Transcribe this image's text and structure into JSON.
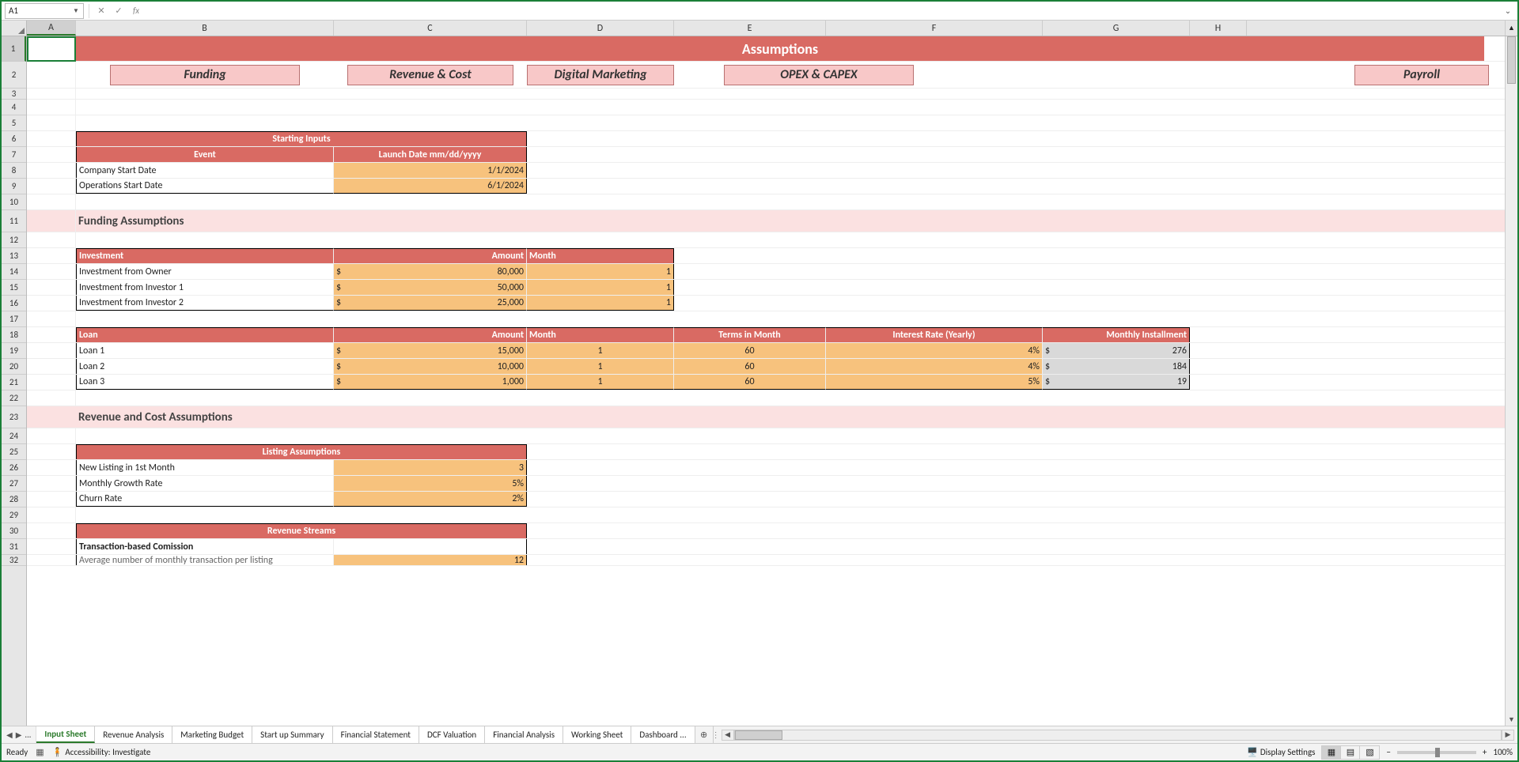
{
  "active_cell": "A1",
  "formula": "",
  "columns": [
    "A",
    "B",
    "C",
    "D",
    "E",
    "F",
    "G",
    "H"
  ],
  "row_numbers": [
    1,
    2,
    3,
    4,
    5,
    6,
    7,
    8,
    9,
    10,
    11,
    12,
    13,
    14,
    15,
    16,
    17,
    18,
    19,
    20,
    21,
    22,
    23,
    24,
    25,
    26,
    27,
    28,
    29,
    30,
    31,
    32
  ],
  "sheet": {
    "title": "Assumptions",
    "tabs": [
      "Funding",
      "Revenue & Cost",
      "Digital Marketing",
      "OPEX & CAPEX",
      "Payroll"
    ],
    "starting_inputs": {
      "header": "Starting Inputs",
      "col1": "Event",
      "col2": "Launch Date mm/dd/yyyy",
      "rows": [
        {
          "event": "Company Start Date",
          "date": "1/1/2024"
        },
        {
          "event": "Operations Start Date",
          "date": "6/1/2024"
        }
      ]
    },
    "section1": "Funding Assumptions",
    "investment": {
      "label": "Investment",
      "amount": "Amount",
      "month": "Month",
      "rows": [
        {
          "name": "Investment from Owner",
          "dollar": "$",
          "amount": "80,000",
          "month": "1"
        },
        {
          "name": "Investment from Investor 1",
          "dollar": "$",
          "amount": "50,000",
          "month": "1"
        },
        {
          "name": "Investment from Investor 2",
          "dollar": "$",
          "amount": "25,000",
          "month": "1"
        }
      ]
    },
    "loan": {
      "label": "Loan",
      "amount": "Amount",
      "month": "Month",
      "terms": "Terms in Month",
      "rate": "Interest Rate (Yearly)",
      "installment": "Monthly Installment",
      "rows": [
        {
          "name": "Loan 1",
          "dollar": "$",
          "amount": "15,000",
          "month": "1",
          "terms": "60",
          "rate": "4%",
          "d2": "$",
          "inst": "276"
        },
        {
          "name": "Loan 2",
          "dollar": "$",
          "amount": "10,000",
          "month": "1",
          "terms": "60",
          "rate": "4%",
          "d2": "$",
          "inst": "184"
        },
        {
          "name": "Loan 3",
          "dollar": "$",
          "amount": "1,000",
          "month": "1",
          "terms": "60",
          "rate": "5%",
          "d2": "$",
          "inst": "19"
        }
      ]
    },
    "section2": "Revenue and Cost Assumptions",
    "listing": {
      "header": "Listing Assumptions",
      "rows": [
        {
          "name": "New Listing in 1st Month",
          "val": "3"
        },
        {
          "name": "Monthly Growth Rate",
          "val": "5%"
        },
        {
          "name": "Churn Rate",
          "val": "2%"
        }
      ]
    },
    "revenue_streams": {
      "header": "Revenue Streams",
      "sub": "Transaction-based Comission",
      "row": {
        "name": "Average number of monthly transaction per listing",
        "val": "12"
      }
    }
  },
  "workbook_tabs": [
    "Input Sheet",
    "Revenue Analysis",
    "Marketing Budget",
    "Start up Summary",
    "Financial Statement",
    "DCF Valuation",
    "Financial Analysis",
    "Working Sheet",
    "Dashboard ..."
  ],
  "active_workbook_tab": "Input Sheet",
  "status": {
    "ready": "Ready",
    "accessibility": "Accessibility: Investigate",
    "display": "Display Settings",
    "zoom": "100%"
  }
}
